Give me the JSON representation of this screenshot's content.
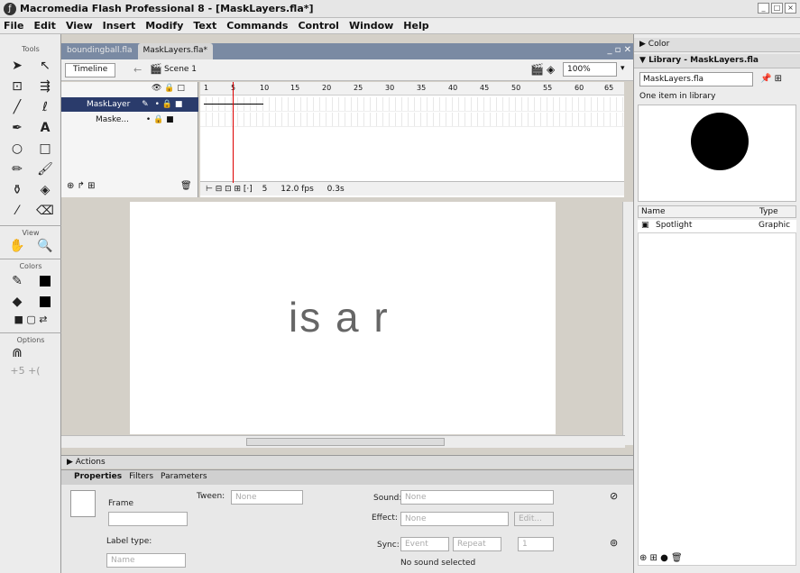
{
  "window": {
    "title": "Macromedia Flash Professional 8 - [MaskLayers.fla*]",
    "controls": [
      "_",
      "□",
      "×"
    ]
  },
  "menu": [
    "File",
    "Edit",
    "View",
    "Insert",
    "Modify",
    "Text",
    "Commands",
    "Control",
    "Window",
    "Help"
  ],
  "tools": {
    "header": "Tools",
    "view_label": "View",
    "colors_label": "Colors",
    "options_label": "Options"
  },
  "doc_tabs": [
    "boundingball.fla",
    "MaskLayers.fla*"
  ],
  "timeline": {
    "button": "Timeline",
    "scene": "Scene 1",
    "zoom": "100%",
    "frame_numbers": [
      "1",
      "5",
      "10",
      "15",
      "20",
      "25",
      "30",
      "35",
      "40",
      "45",
      "50",
      "55",
      "60",
      "65"
    ],
    "layers": [
      {
        "name": "MaskLayer",
        "selected": true
      },
      {
        "name": "Maske...",
        "selected": false
      }
    ],
    "status": {
      "current_frame": "5",
      "fps": "12.0 fps",
      "time": "0.3s"
    }
  },
  "stage": {
    "text": "is a r"
  },
  "actions_label": "Actions",
  "properties": {
    "tabs": [
      "Properties",
      "Filters",
      "Parameters"
    ],
    "frame_label": "Frame",
    "tween_label": "Tween:",
    "tween_value": "None",
    "sound_label": "Sound:",
    "sound_value": "None",
    "effect_label": "Effect:",
    "effect_value": "None",
    "edit_button": "Edit...",
    "label_type_label": "Label type:",
    "label_type_value": "Name",
    "sync_label": "Sync:",
    "sync_value": "Event",
    "repeat_value": "Repeat",
    "repeat_count": "1",
    "no_sound": "No sound selected"
  },
  "right_panel": {
    "color_header": "Color",
    "library_header": "Library - MaskLayers.fla",
    "library_file": "MaskLayers.fla",
    "item_count": "One item in library",
    "col_name": "Name",
    "col_type": "Type",
    "items": [
      {
        "name": "Spotlight",
        "type": "Graphic"
      }
    ]
  }
}
